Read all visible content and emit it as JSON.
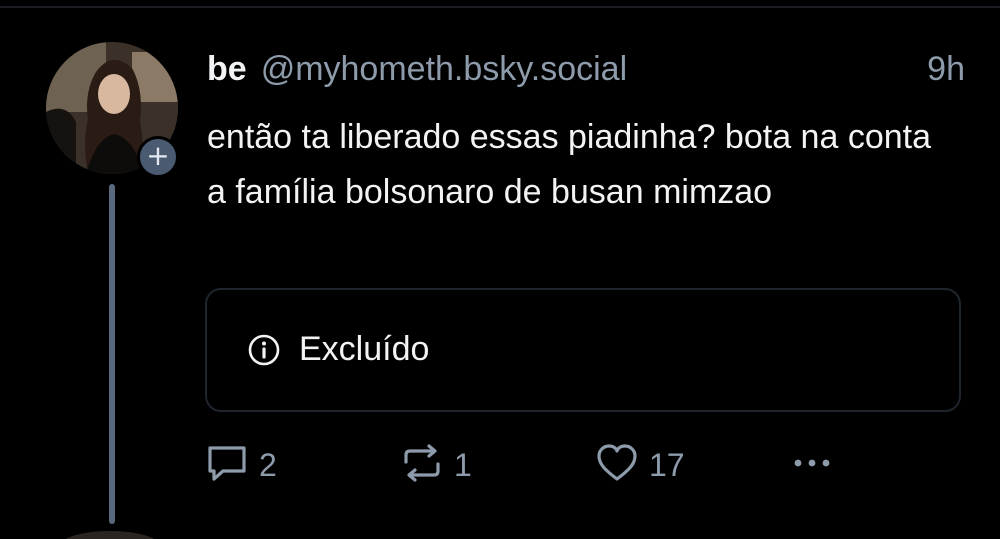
{
  "post": {
    "author": {
      "display_name": "be",
      "handle": "@myhometh.bsky.social",
      "avatar_icon": "avatar-photo",
      "follow_badge": "+"
    },
    "timestamp": "9h",
    "text": "então ta liberado essas piadinha? bota na conta a família bolsonaro de busan mimzao",
    "embed": {
      "icon": "info-icon",
      "label": "Excluído"
    },
    "actions": {
      "reply": {
        "icon": "reply-icon",
        "count": "2"
      },
      "repost": {
        "icon": "repost-icon",
        "count": "1"
      },
      "like": {
        "icon": "heart-icon",
        "count": "17"
      },
      "more": {
        "icon": "more-dots-icon"
      }
    }
  },
  "colors": {
    "background": "#000000",
    "text_primary": "#f1f3f5",
    "text_secondary": "#8d9bab",
    "thread_line": "#5a6a7e",
    "border": "#1f252d"
  }
}
